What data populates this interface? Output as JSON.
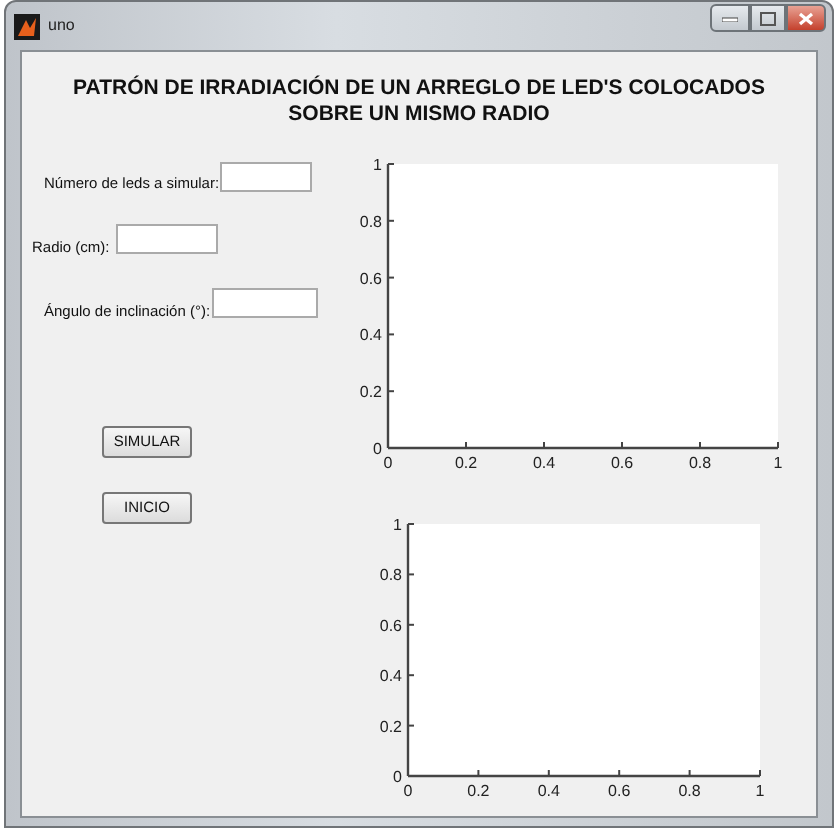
{
  "window": {
    "title": "uno"
  },
  "heading": "PATRÓN DE IRRADIACIÓN DE UN ARREGLO DE LED'S COLOCADOS\nSOBRE UN MISMO RADIO",
  "fields": [
    {
      "label": "Número de leds a simular:"
    },
    {
      "label": "Radio (cm):"
    },
    {
      "label": "Ángulo de inclinación (°):"
    }
  ],
  "buttons": [
    "SIMULAR",
    "INICIO"
  ],
  "plots": [
    {
      "chart_data": {
        "type": "line",
        "xlim": [
          0,
          1
        ],
        "ylim": [
          0,
          1
        ],
        "xticks": [
          0,
          0.2,
          0.4,
          0.6,
          0.8,
          1
        ],
        "yticks": [
          0,
          0.2,
          0.4,
          0.6,
          0.8,
          1
        ]
      }
    },
    {
      "chart_data": {
        "type": "line",
        "xlim": [
          0,
          1
        ],
        "ylim": [
          0,
          1
        ],
        "xticks": [
          0,
          0.2,
          0.4,
          0.6,
          0.8,
          1
        ],
        "yticks": [
          0,
          0.2,
          0.4,
          0.6,
          0.8,
          1
        ]
      }
    }
  ]
}
